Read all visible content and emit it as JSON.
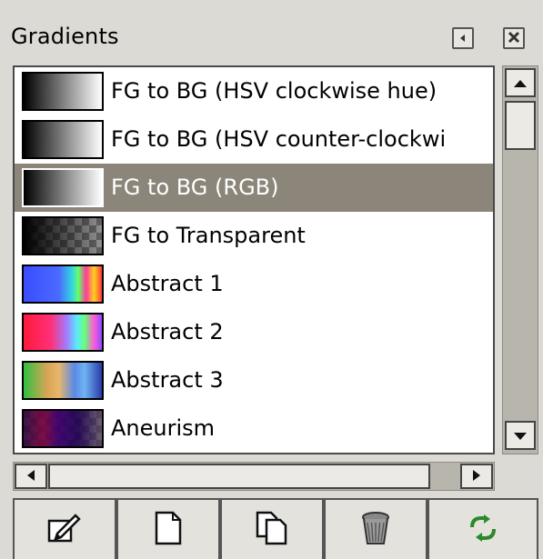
{
  "panel": {
    "title": "Gradients"
  },
  "header_buttons": [
    {
      "icon": "menu-arrow-icon"
    },
    {
      "icon": "close-icon"
    }
  ],
  "gradients": [
    {
      "label": "FG to BG (HSV clockwise hue)",
      "selected": false,
      "swatch": "fg-bg"
    },
    {
      "label": "FG to BG (HSV counter-clockwi",
      "selected": false,
      "swatch": "fg-bg"
    },
    {
      "label": "FG to BG (RGB)",
      "selected": true,
      "swatch": "fg-bg"
    },
    {
      "label": "FG to Transparent",
      "selected": false,
      "swatch": "fg-transparent"
    },
    {
      "label": "Abstract 1",
      "selected": false,
      "swatch": "abstract-1"
    },
    {
      "label": "Abstract 2",
      "selected": false,
      "swatch": "abstract-2"
    },
    {
      "label": "Abstract 3",
      "selected": false,
      "swatch": "abstract-3"
    },
    {
      "label": "Aneurism",
      "selected": false,
      "swatch": "aneurism"
    }
  ],
  "toolbar": [
    {
      "icon": "edit-icon",
      "action": "edit-gradient"
    },
    {
      "icon": "new-document-icon",
      "action": "new-gradient"
    },
    {
      "icon": "duplicate-icon",
      "action": "duplicate-gradient"
    },
    {
      "icon": "trash-icon",
      "action": "delete-gradient"
    },
    {
      "icon": "refresh-icon",
      "action": "refresh-gradients"
    }
  ],
  "colors": {
    "background": "#dcdad5",
    "selection": "#8b857a",
    "selection_text": "#ffffff"
  }
}
